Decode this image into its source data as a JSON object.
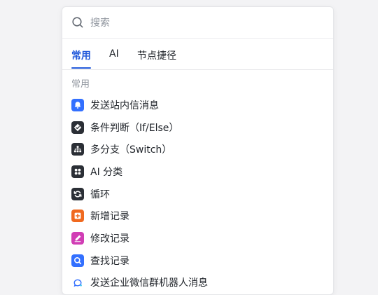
{
  "search": {
    "placeholder": "搜索",
    "value": ""
  },
  "tabs": [
    {
      "label": "常用",
      "active": true
    },
    {
      "label": "AI",
      "active": false
    },
    {
      "label": "节点捷径",
      "active": false
    }
  ],
  "section": {
    "title": "常用"
  },
  "items": [
    {
      "label": "发送站内信消息",
      "icon": "bell-icon",
      "color": "#3370ff"
    },
    {
      "label": "条件判断（If/Else）",
      "icon": "condition-diamond-icon",
      "color": "#2b2f36"
    },
    {
      "label": "多分支（Switch）",
      "icon": "branch-tree-icon",
      "color": "#2b2f36"
    },
    {
      "label": "AI 分类",
      "icon": "grid-dots-icon",
      "color": "#2b2f36"
    },
    {
      "label": "循环",
      "icon": "loop-icon",
      "color": "#2b2f36"
    },
    {
      "label": "新增记录",
      "icon": "add-record-icon",
      "color": "#f0691f"
    },
    {
      "label": "修改记录",
      "icon": "edit-record-icon",
      "color": "#d13eb5"
    },
    {
      "label": "查找记录",
      "icon": "search-record-icon",
      "color": "#3370ff"
    },
    {
      "label": "发送企业微信群机器人消息",
      "icon": "wecom-icon",
      "color": "#3370ff"
    }
  ]
}
